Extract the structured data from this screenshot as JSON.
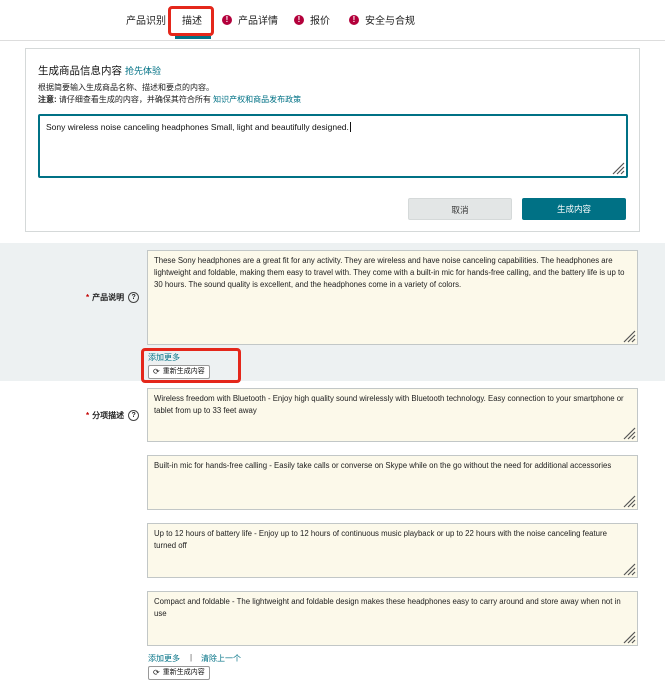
{
  "tabs": [
    {
      "label": "产品识别",
      "alert": false
    },
    {
      "label": "描述",
      "alert": false,
      "active": true
    },
    {
      "label": "产品详情",
      "alert": true
    },
    {
      "label": "报价",
      "alert": true
    },
    {
      "label": "安全与合规",
      "alert": true
    }
  ],
  "generate": {
    "title": "生成商品信息内容",
    "early_access": "抢先体验",
    "description": "根据简要输入生成商品名称、描述和要点的内容。",
    "note_label": "注意:",
    "note_text": "请仔细查看生成的内容，并确保其符合所有",
    "note_link": "知识产权和商品发布政策",
    "input_value": "Sony wireless noise canceling headphones Small, light and beautifully designed.",
    "cancel_label": "取消",
    "generate_label": "生成内容"
  },
  "product_description": {
    "label": "产品说明",
    "value": "These Sony headphones are a great fit for any activity. They are wireless and have noise canceling capabilities. The headphones are lightweight and foldable, making them easy to travel with. They come with a built-in mic for hands-free calling, and the battery life is up to 30 hours. The sound quality is excellent, and the headphones come in a variety of colors.",
    "add_more": "添加更多",
    "regenerate": "重新生成内容"
  },
  "bullet_points": {
    "label": "分项描述",
    "items": [
      "Wireless freedom with Bluetooth - Enjoy high quality sound wirelessly with Bluetooth technology. Easy connection to your smartphone or tablet from up to 33 feet away",
      "Built-in mic for hands-free calling - Easily take calls or converse on Skype while on the go without the need for additional accessories",
      "Up to 12 hours of battery life - Enjoy up to 12 hours of continuous music playback or up to 22 hours with the noise canceling feature turned off",
      "Compact and foldable - The lightweight and foldable design makes these headphones easy to carry around and store away when not in use"
    ],
    "add_more": "添加更多",
    "separator": "|",
    "clear_last": "清除上一个",
    "regenerate": "重新生成内容"
  },
  "colors": {
    "accent": "#007185",
    "highlight_annotation": "#e4271b",
    "alert": "#b3003b",
    "textarea_bg": "#fcf9ea",
    "band_bg": "#edf1f2"
  }
}
